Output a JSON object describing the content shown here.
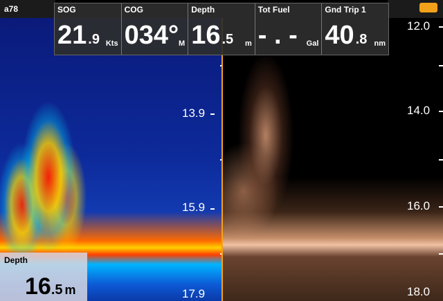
{
  "top_left_label": "a78",
  "metrics": [
    {
      "label": "SOG",
      "main": "21",
      "fraction": ".9",
      "unit": "Kts"
    },
    {
      "label": "COG",
      "main": "034°",
      "fraction": "",
      "unit": "M"
    },
    {
      "label": "Depth",
      "main": "16",
      "fraction": ".5",
      "unit": "m"
    },
    {
      "label": "Tot Fuel",
      "main": "- . -",
      "fraction": "",
      "unit": "Gal"
    },
    {
      "label": "Gnd Trip 1",
      "main": "40",
      "fraction": ".8",
      "unit": "nm"
    }
  ],
  "left_scale": [
    "13.9",
    "15.9",
    "17.9"
  ],
  "right_scale": [
    "12.0",
    "14.0",
    "16.0",
    "18.0"
  ],
  "depth_box": {
    "label": "Depth",
    "main": "16",
    "fraction": ".5",
    "unit": "m"
  },
  "icons": {
    "boat": "boat-icon"
  },
  "colors": {
    "accent": "#f2a21a"
  }
}
